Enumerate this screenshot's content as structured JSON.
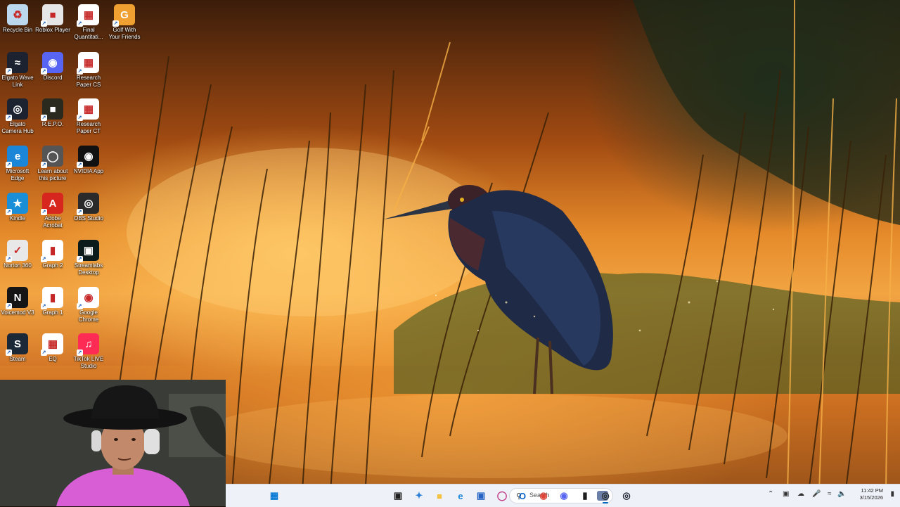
{
  "desktop": {
    "icons": [
      {
        "label": "Recycle Bin",
        "icon": "recycle-bin-icon",
        "color": "#bcd8ee"
      },
      {
        "label": "Roblox Player",
        "icon": "roblox-icon",
        "color": "#e6e6e6"
      },
      {
        "label": "Final Quantitati...",
        "icon": "pdf-document-icon",
        "color": "#ffffff"
      },
      {
        "label": "Golf With Your Friends",
        "icon": "golf-game-icon",
        "color": "#f0a030"
      },
      {
        "label": "Elgato Wave Link",
        "icon": "wave-link-icon",
        "color": "#1c2230"
      },
      {
        "label": "Discord",
        "icon": "discord-icon",
        "color": "#5865f2"
      },
      {
        "label": "Research Paper CS",
        "icon": "pdf-document-icon",
        "color": "#ffffff"
      },
      {
        "label": "Elgato Camera Hub",
        "icon": "camera-hub-icon",
        "color": "#1c2230"
      },
      {
        "label": "R.E.P.O.",
        "icon": "repo-game-icon",
        "color": "#2a2a1e"
      },
      {
        "label": "Research Paper CT",
        "icon": "pdf-document-icon",
        "color": "#ffffff"
      },
      {
        "label": "Microsoft Edge",
        "icon": "edge-icon",
        "color": "#1b86d8"
      },
      {
        "label": "Learn about this picture",
        "icon": "learn-picture-icon",
        "color": "#555555"
      },
      {
        "label": "NVIDIA App",
        "icon": "nvidia-icon",
        "color": "#111111"
      },
      {
        "label": "Kindle",
        "icon": "kindle-icon",
        "color": "#1a8fd8"
      },
      {
        "label": "Adobe Acrobat",
        "icon": "acrobat-icon",
        "color": "#d7261e"
      },
      {
        "label": "OBS Studio",
        "icon": "obs-icon",
        "color": "#2a2a2a"
      },
      {
        "label": "Norton 360",
        "icon": "norton-icon",
        "color": "#e8e8e8"
      },
      {
        "label": "Graph 2",
        "icon": "graph-file-icon",
        "color": "#ffffff"
      },
      {
        "label": "Streamlabs Desktop",
        "icon": "streamlabs-icon",
        "color": "#0b1a1a"
      },
      {
        "label": "Voicemod V3",
        "icon": "voicemod-icon",
        "color": "#151515"
      },
      {
        "label": "Graph 1",
        "icon": "graph-file-icon",
        "color": "#ffffff"
      },
      {
        "label": "Google Chrome",
        "icon": "chrome-icon",
        "color": "#ffffff"
      },
      {
        "label": "Steam",
        "icon": "steam-icon",
        "color": "#1b2838"
      },
      {
        "label": "EQ",
        "icon": "pdf-document-icon",
        "color": "#ffffff"
      },
      {
        "label": "TikTok LIVE Studio",
        "icon": "tiktok-live-icon",
        "color": "#fe2c55"
      }
    ]
  },
  "taskbar": {
    "search_placeholder": "Search",
    "apps": [
      {
        "name": "start-button",
        "icon": "windows-start-icon",
        "color": "#0078d4",
        "active": false
      },
      {
        "name": "task-view-button",
        "icon": "task-view-icon",
        "color": "#202020",
        "active": false
      },
      {
        "name": "copilot-button",
        "icon": "copilot-icon",
        "color": "#2b7fd6",
        "active": false
      },
      {
        "name": "file-explorer-button",
        "icon": "folder-icon",
        "color": "#f4c242",
        "active": false
      },
      {
        "name": "edge-button",
        "icon": "edge-icon",
        "color": "#1b86d8",
        "active": false
      },
      {
        "name": "store-button",
        "icon": "store-icon",
        "color": "#2364c4",
        "active": false
      },
      {
        "name": "instagram-button",
        "icon": "instagram-icon",
        "color": "#c13584",
        "active": false
      },
      {
        "name": "outlook-button",
        "icon": "outlook-icon",
        "color": "#0a64c8",
        "active": false
      },
      {
        "name": "chrome-button",
        "icon": "chrome-icon",
        "color": "#db4437",
        "active": false
      },
      {
        "name": "discord-button",
        "icon": "discord-icon",
        "color": "#5865f2",
        "active": false
      },
      {
        "name": "terminal-button",
        "icon": "terminal-icon",
        "color": "#1e1e1e",
        "active": false
      },
      {
        "name": "obs-button",
        "icon": "obs-icon",
        "color": "#2a2a2a",
        "active": true
      },
      {
        "name": "camera-hub-button",
        "icon": "camera-hub-icon",
        "color": "#1c2230",
        "active": false
      }
    ],
    "clock": {
      "time": "11:42 PM",
      "date": "3/15/2026"
    }
  }
}
